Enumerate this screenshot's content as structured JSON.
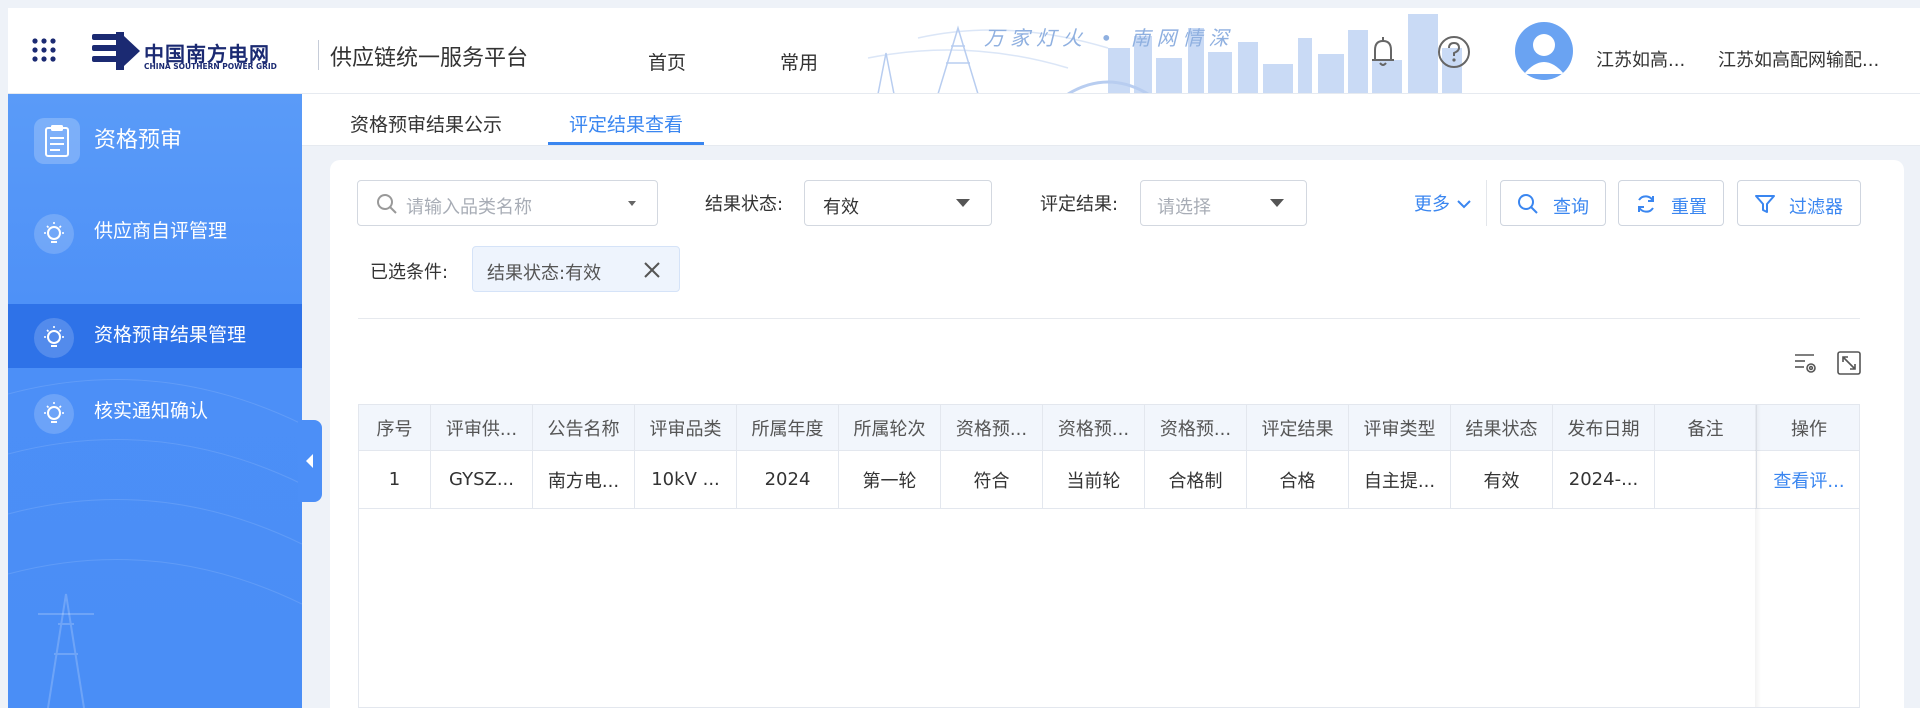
{
  "header": {
    "logo_cn": "中国南方电网",
    "logo_en": "CHINA SOUTHERN POWER GRID",
    "platform_title": "供应链统一服务平台",
    "nav": [
      "首页",
      "常用"
    ],
    "slogan": "万家灯火 • 南网情深",
    "user_short": "江苏如高...",
    "org_short": "江苏如高配网输配...",
    "icons": [
      "apps-grid-icon",
      "bell-icon",
      "help-icon",
      "user-avatar-icon"
    ]
  },
  "sidebar": {
    "title": "资格预审",
    "items": [
      {
        "label": "供应商自评管理",
        "active": false
      },
      {
        "label": "资格预审结果管理",
        "active": true
      },
      {
        "label": "核实通知确认",
        "active": false
      }
    ]
  },
  "tabs": [
    {
      "label": "资格预审结果公示",
      "active": false
    },
    {
      "label": "评定结果查看",
      "active": true
    }
  ],
  "filters": {
    "category_placeholder": "请输入品类名称",
    "status_label": "结果状态:",
    "status_value": "有效",
    "result_label": "评定结果:",
    "result_placeholder": "请选择",
    "more_label": "更多",
    "query_label": "查询",
    "reset_label": "重置",
    "filter_label": "过滤器"
  },
  "selected": {
    "label": "已选条件:",
    "chips": [
      "结果状态:有效"
    ]
  },
  "table": {
    "columns": [
      "序号",
      "评审供...",
      "公告名称",
      "评审品类",
      "所属年度",
      "所属轮次",
      "资格预...",
      "资格预...",
      "资格预...",
      "评定结果",
      "评审类型",
      "结果状态",
      "发布日期",
      "备注",
      "操作"
    ],
    "rows": [
      [
        "1",
        "GYSZ...",
        "南方电...",
        "10kV ...",
        "2024",
        "第一轮",
        "符合",
        "当前轮",
        "合格制",
        "合格",
        "自主提...",
        "有效",
        "2024-...",
        "",
        "查看评..."
      ]
    ]
  },
  "colors": {
    "primary": "#3a86f0",
    "sidebar": "#4c8ff7",
    "sidebar_active": "#2e72e8",
    "brand_navy": "#1b2a72"
  }
}
